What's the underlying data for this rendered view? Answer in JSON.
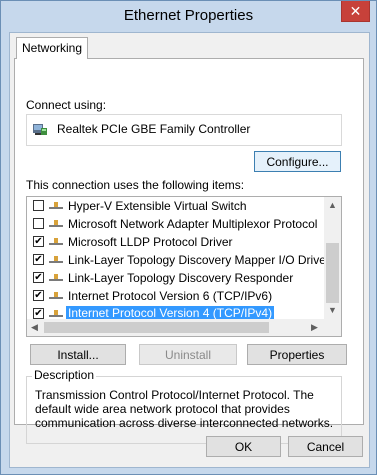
{
  "window": {
    "title": "Ethernet Properties",
    "close_glyph": "✕"
  },
  "tabs": [
    {
      "label": "Networking"
    }
  ],
  "connect_using_label": "Connect using:",
  "adapter": {
    "name": "Realtek PCIe GBE Family Controller",
    "icon": "network-adapter-icon"
  },
  "configure_label": "Configure...",
  "items_label": "This connection uses the following items:",
  "items": [
    {
      "label": "Hyper-V Extensible Virtual Switch",
      "checked": false,
      "selected": false
    },
    {
      "label": "Microsoft Network Adapter Multiplexor Protocol",
      "checked": false,
      "selected": false
    },
    {
      "label": "Microsoft LLDP Protocol Driver",
      "checked": true,
      "selected": false
    },
    {
      "label": "Link-Layer Topology Discovery Mapper I/O Driver",
      "checked": true,
      "selected": false
    },
    {
      "label": "Link-Layer Topology Discovery Responder",
      "checked": true,
      "selected": false
    },
    {
      "label": "Internet Protocol Version 6 (TCP/IPv6)",
      "checked": true,
      "selected": false
    },
    {
      "label": "Internet Protocol Version 4 (TCP/IPv4)",
      "checked": true,
      "selected": true
    }
  ],
  "buttons": {
    "install": "Install...",
    "uninstall": "Uninstall",
    "properties": "Properties",
    "ok": "OK",
    "cancel": "Cancel"
  },
  "description": {
    "title": "Description",
    "text": "Transmission Control Protocol/Internet Protocol. The default wide area network protocol that provides communication across diverse interconnected networks."
  },
  "colors": {
    "selection": "#3399ff",
    "close": "#c7413a",
    "frame": "#c6d8ec"
  }
}
